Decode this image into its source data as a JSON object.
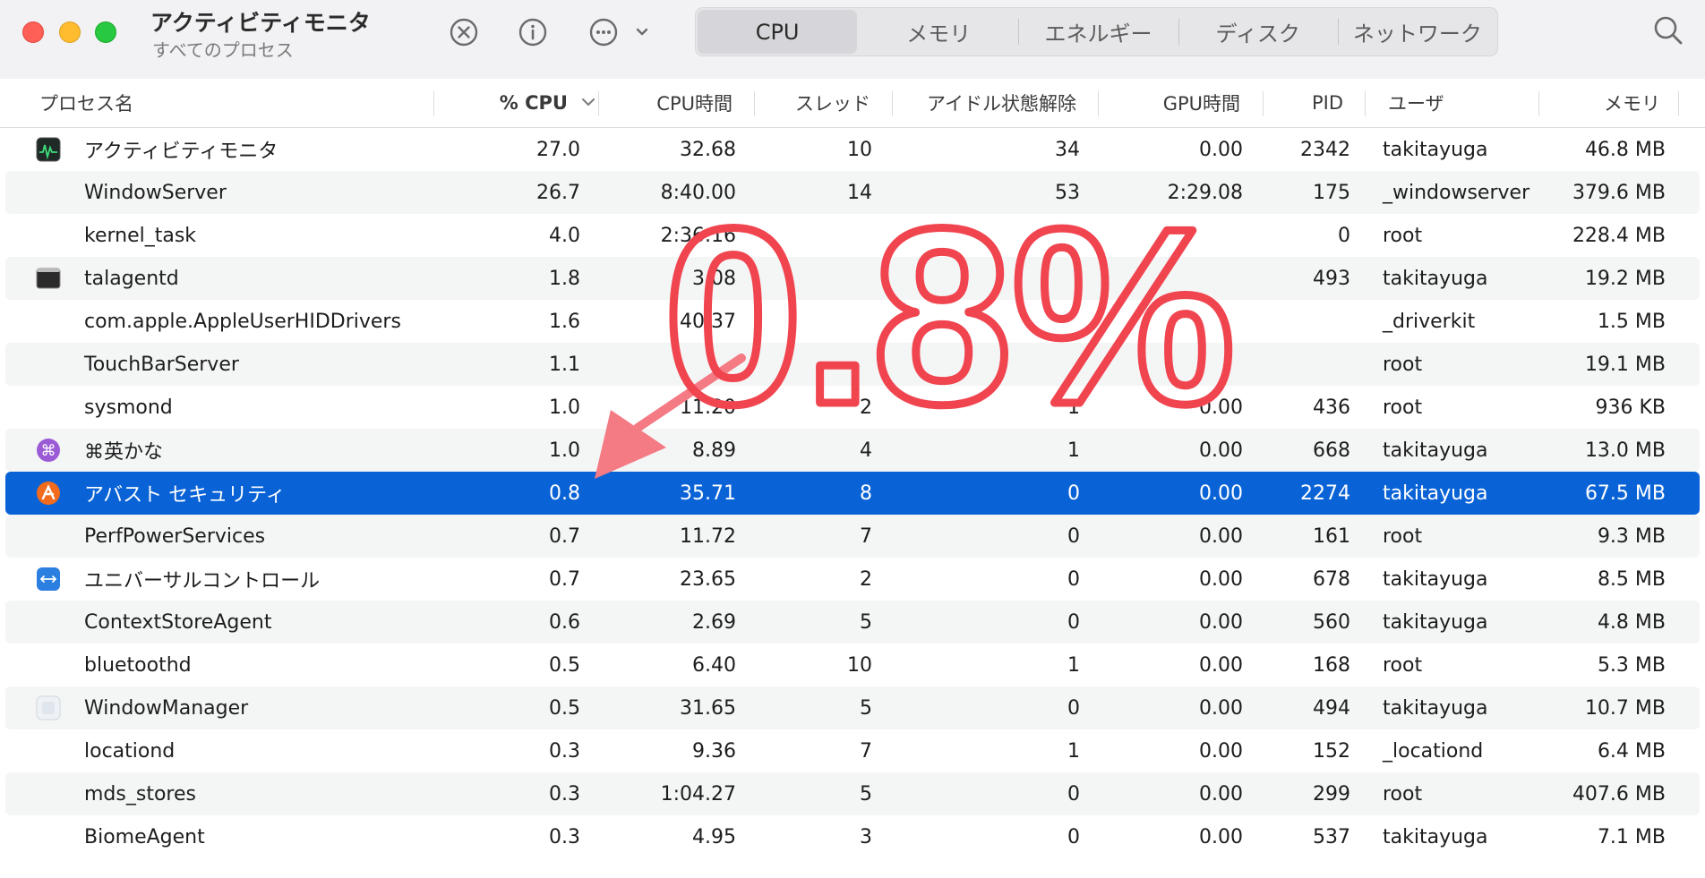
{
  "window": {
    "title": "アクティビティモニタ",
    "subtitle": "すべてのプロセス"
  },
  "toolbar": {
    "stop_icon": "stop-process-icon",
    "info_icon": "info-icon",
    "more_icon": "more-options-icon",
    "search_icon": "search-icon",
    "tabs": [
      {
        "label": "CPU",
        "active": true
      },
      {
        "label": "メモリ",
        "active": false
      },
      {
        "label": "エネルギー",
        "active": false
      },
      {
        "label": "ディスク",
        "active": false
      },
      {
        "label": "ネットワーク",
        "active": false
      }
    ]
  },
  "table": {
    "headers": {
      "name": "プロセス名",
      "cpu": "% CPU",
      "cpu_time": "CPU時間",
      "threads": "スレッド",
      "idle_wakeups": "アイドル状態解除",
      "gpu_time": "GPU時間",
      "pid": "PID",
      "user": "ユーザ",
      "memory": "メモリ"
    },
    "sort_column": "cpu",
    "sort_direction": "descending",
    "rows": [
      {
        "name": "アクティビティモニタ",
        "cpu": "27.0",
        "cpu_time": "32.68",
        "threads": "10",
        "idle": "34",
        "gpu": "0.00",
        "pid": "2342",
        "user": "takitayuga",
        "mem": "46.8 MB",
        "icon": "activity-monitor-icon"
      },
      {
        "name": "WindowServer",
        "cpu": "26.7",
        "cpu_time": "8:40.00",
        "threads": "14",
        "idle": "53",
        "gpu": "2:29.08",
        "pid": "175",
        "user": "_windowserver",
        "mem": "379.6 MB",
        "icon": ""
      },
      {
        "name": "kernel_task",
        "cpu": "4.0",
        "cpu_time": "2:36.16",
        "threads": "",
        "idle": "",
        "gpu": "",
        "pid": "0",
        "user": "root",
        "mem": "228.4 MB",
        "icon": ""
      },
      {
        "name": "talagentd",
        "cpu": "1.8",
        "cpu_time": "3.08",
        "threads": "",
        "idle": "",
        "gpu": "",
        "pid": "493",
        "user": "takitayuga",
        "mem": "19.2 MB",
        "icon": "terminal-icon"
      },
      {
        "name": "com.apple.AppleUserHIDDrivers",
        "cpu": "1.6",
        "cpu_time": "40.37",
        "threads": "",
        "idle": "",
        "gpu": "",
        "pid": "",
        "user": "_driverkit",
        "mem": "1.5 MB",
        "icon": ""
      },
      {
        "name": "TouchBarServer",
        "cpu": "1.1",
        "cpu_time": "",
        "threads": "",
        "idle": "",
        "gpu": "",
        "pid": "",
        "user": "root",
        "mem": "19.1 MB",
        "icon": ""
      },
      {
        "name": "sysmond",
        "cpu": "1.0",
        "cpu_time": "11.20",
        "threads": "2",
        "idle": "1",
        "gpu": "0.00",
        "pid": "436",
        "user": "root",
        "mem": "936 KB",
        "icon": ""
      },
      {
        "name": "⌘英かな",
        "cpu": "1.0",
        "cpu_time": "8.89",
        "threads": "4",
        "idle": "1",
        "gpu": "0.00",
        "pid": "668",
        "user": "takitayuga",
        "mem": "13.0 MB",
        "icon": "command-key-icon"
      },
      {
        "name": "アバスト セキュリティ",
        "cpu": "0.8",
        "cpu_time": "35.71",
        "threads": "8",
        "idle": "0",
        "gpu": "0.00",
        "pid": "2274",
        "user": "takitayuga",
        "mem": "67.5 MB",
        "icon": "avast-icon",
        "selected": true
      },
      {
        "name": "PerfPowerServices",
        "cpu": "0.7",
        "cpu_time": "11.72",
        "threads": "7",
        "idle": "0",
        "gpu": "0.00",
        "pid": "161",
        "user": "root",
        "mem": "9.3 MB",
        "icon": ""
      },
      {
        "name": "ユニバーサルコントロール",
        "cpu": "0.7",
        "cpu_time": "23.65",
        "threads": "2",
        "idle": "0",
        "gpu": "0.00",
        "pid": "678",
        "user": "takitayuga",
        "mem": "8.5 MB",
        "icon": "universal-control-icon"
      },
      {
        "name": "ContextStoreAgent",
        "cpu": "0.6",
        "cpu_time": "2.69",
        "threads": "5",
        "idle": "0",
        "gpu": "0.00",
        "pid": "560",
        "user": "takitayuga",
        "mem": "4.8 MB",
        "icon": ""
      },
      {
        "name": "bluetoothd",
        "cpu": "0.5",
        "cpu_time": "6.40",
        "threads": "10",
        "idle": "1",
        "gpu": "0.00",
        "pid": "168",
        "user": "root",
        "mem": "5.3 MB",
        "icon": ""
      },
      {
        "name": "WindowManager",
        "cpu": "0.5",
        "cpu_time": "31.65",
        "threads": "5",
        "idle": "0",
        "gpu": "0.00",
        "pid": "494",
        "user": "takitayuga",
        "mem": "10.7 MB",
        "icon": "window-manager-icon"
      },
      {
        "name": "locationd",
        "cpu": "0.3",
        "cpu_time": "9.36",
        "threads": "7",
        "idle": "1",
        "gpu": "0.00",
        "pid": "152",
        "user": "_locationd",
        "mem": "6.4 MB",
        "icon": ""
      },
      {
        "name": "mds_stores",
        "cpu": "0.3",
        "cpu_time": "1:04.27",
        "threads": "5",
        "idle": "0",
        "gpu": "0.00",
        "pid": "299",
        "user": "root",
        "mem": "407.6 MB",
        "icon": ""
      },
      {
        "name": "BiomeAgent",
        "cpu": "0.3",
        "cpu_time": "4.95",
        "threads": "3",
        "idle": "0",
        "gpu": "0.00",
        "pid": "537",
        "user": "takitayuga",
        "mem": "7.1 MB",
        "icon": ""
      }
    ]
  },
  "annotation": {
    "text": "0.8%",
    "color": "#f0444f",
    "arrow_color": "#f47a84",
    "arrow_icon": "arrow-pointer-icon"
  }
}
